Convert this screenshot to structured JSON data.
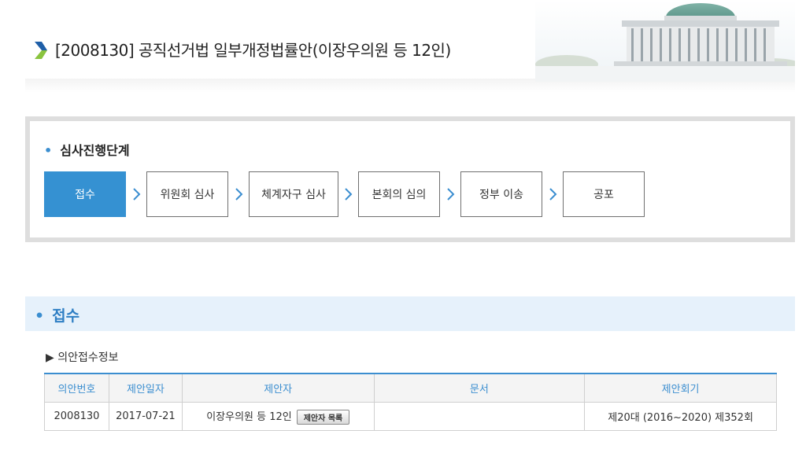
{
  "header": {
    "title": "[2008130] 공직선거법 일부개정법률안(이장우의원 등 12인)"
  },
  "stages": {
    "heading": "심사진행단계",
    "steps": [
      {
        "label": "접수",
        "active": true
      },
      {
        "label": "위원회 심사",
        "active": false
      },
      {
        "label": "체계자구 심사",
        "active": false
      },
      {
        "label": "본회의 심의",
        "active": false
      },
      {
        "label": "정부 이송",
        "active": false
      },
      {
        "label": "공포",
        "active": false
      }
    ]
  },
  "section": {
    "title": "접수",
    "subhead": "▶ 의안접수정보"
  },
  "table": {
    "headers": [
      "의안번호",
      "제안일자",
      "제안자",
      "문서",
      "제안회기"
    ],
    "row": {
      "bill_no": "2008130",
      "date": "2017-07-21",
      "proposer": "이장우의원 등 12인",
      "proposer_button": "제안자 목록",
      "document": "",
      "session": "제20대 (2016~2020) 제352회"
    }
  },
  "colors": {
    "accent": "#3591d2",
    "band": "#e6f1fb",
    "section_text": "#2f7fc4"
  }
}
